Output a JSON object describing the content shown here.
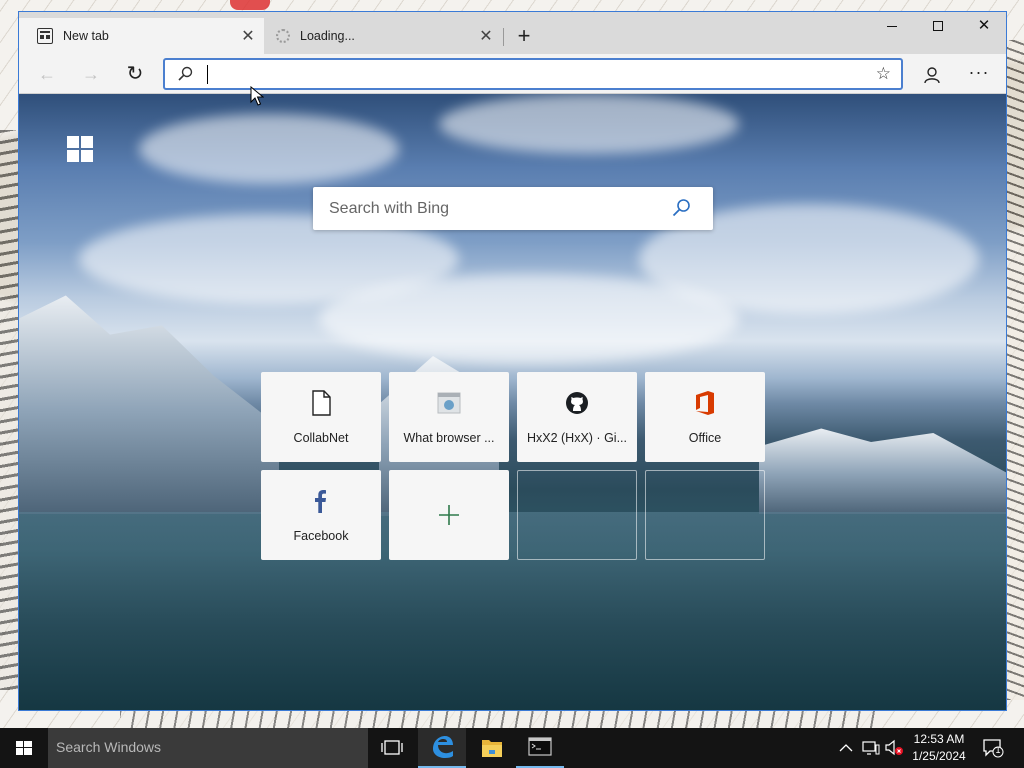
{
  "browser": {
    "tabs": [
      {
        "title": "New tab",
        "close": "✕",
        "active": true
      },
      {
        "title": "Loading...",
        "close": "✕",
        "active": false
      }
    ],
    "new_tab": "+",
    "window_controls": {
      "close": "✕"
    },
    "nav": {
      "back": "←",
      "forward": "→",
      "refresh": "↻"
    },
    "address": {
      "value": "",
      "placeholder": ""
    },
    "favorite": "☆",
    "more": "···"
  },
  "newtab_page": {
    "search_placeholder": "Search with Bing",
    "tiles": [
      {
        "label": "CollabNet",
        "icon": "document-icon"
      },
      {
        "label": "What browser ...",
        "icon": "site-favicon-icon"
      },
      {
        "label": "HxX2 (HxX) · Gi...",
        "icon": "github-icon"
      },
      {
        "label": "Office",
        "icon": "office-icon"
      },
      {
        "label": "Facebook",
        "icon": "facebook-icon"
      },
      {
        "label": "",
        "icon": "add-icon"
      }
    ]
  },
  "taskbar": {
    "search_placeholder": "Search Windows",
    "apps": [
      "task-view-icon",
      "edge-icon",
      "file-explorer-icon",
      "terminal-icon"
    ],
    "clock": {
      "time": "12:53 AM",
      "date": "1/25/2024"
    },
    "notification_count": "1"
  },
  "colors": {
    "accent": "#3a7ad6",
    "office": "#d83b01",
    "facebook": "#3b5998",
    "add": "#2f7a4b",
    "taskbar": "#141414"
  }
}
